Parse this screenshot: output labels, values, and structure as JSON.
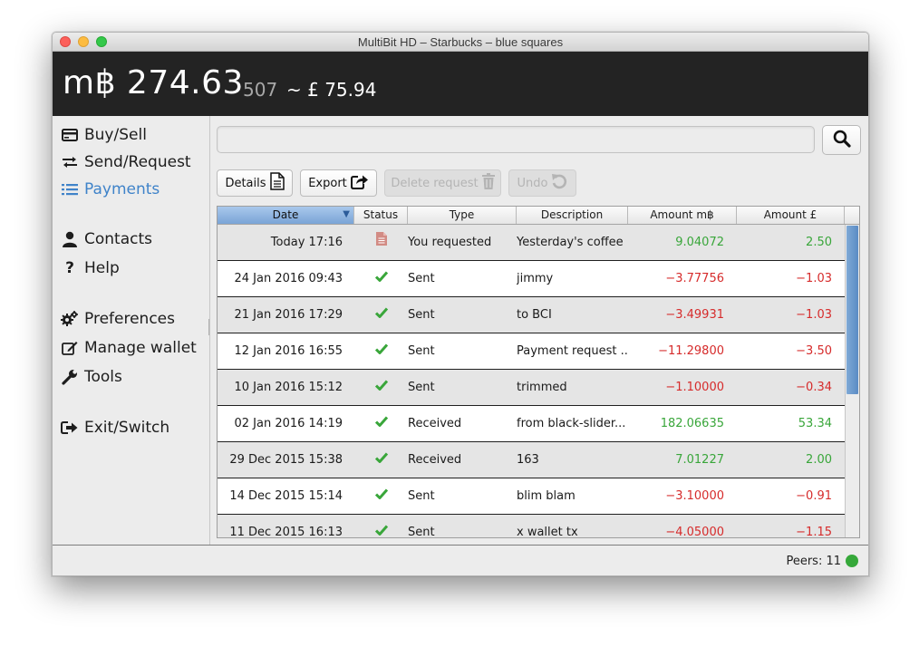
{
  "window": {
    "title": "MultiBit HD – Starbucks – blue squares"
  },
  "header": {
    "balance_main": "m฿ 274.63",
    "balance_small": "507",
    "balance_fiat": "~ £ 75.94"
  },
  "sidebar": {
    "items": [
      {
        "label": "Buy/Sell",
        "icon": "credit-card-icon"
      },
      {
        "label": "Send/Request",
        "icon": "exchange-arrows-icon"
      },
      {
        "label": "Payments",
        "icon": "list-icon",
        "active": true
      },
      {
        "label": "Contacts",
        "icon": "user-icon"
      },
      {
        "label": "Help",
        "icon": "question-icon"
      },
      {
        "label": "Preferences",
        "icon": "cogs-icon"
      },
      {
        "label": "Manage wallet",
        "icon": "edit-icon"
      },
      {
        "label": "Tools",
        "icon": "wrench-icon"
      },
      {
        "label": "Exit/Switch",
        "icon": "sign-out-icon"
      }
    ]
  },
  "search": {
    "value": "",
    "placeholder": "",
    "button_icon": "search-icon"
  },
  "toolbar": {
    "details": "Details",
    "export": "Export",
    "delete_request": "Delete request",
    "undo": "Undo"
  },
  "table": {
    "columns": [
      "Date",
      "Status",
      "Type",
      "Description",
      "Amount  m฿",
      "Amount £"
    ],
    "rows": [
      {
        "date": "Today 17:16",
        "status": "document-icon",
        "type": "You requested",
        "description": "Yesterday's coffee",
        "amount": "9.04072",
        "fiat": "2.50"
      },
      {
        "date": "24 Jan 2016 09:43",
        "status": "check-icon",
        "type": "Sent",
        "description": "jimmy",
        "amount": "−3.77756",
        "fiat": "−1.03"
      },
      {
        "date": "21 Jan 2016 17:29",
        "status": "check-icon",
        "type": "Sent",
        "description": "to BCI",
        "amount": "−3.49931",
        "fiat": "−1.03"
      },
      {
        "date": "12 Jan 2016 16:55",
        "status": "check-icon",
        "type": "Sent",
        "description": "Payment request ...",
        "amount": "−11.29800",
        "fiat": "−3.50"
      },
      {
        "date": "10 Jan 2016 15:12",
        "status": "check-icon",
        "type": "Sent",
        "description": "trimmed",
        "amount": "−1.10000",
        "fiat": "−0.34"
      },
      {
        "date": "02 Jan 2016 14:19",
        "status": "check-icon",
        "type": "Received",
        "description": "from black-slider...",
        "amount": "182.06635",
        "fiat": "53.34"
      },
      {
        "date": "29 Dec 2015 15:38",
        "status": "check-icon",
        "type": "Received",
        "description": "163",
        "amount": "7.01227",
        "fiat": "2.00"
      },
      {
        "date": "14 Dec 2015 15:14",
        "status": "check-icon",
        "type": "Sent",
        "description": "blim blam",
        "amount": "−3.10000",
        "fiat": "−0.91"
      },
      {
        "date": "11 Dec 2015 16:13",
        "status": "check-icon",
        "type": "Sent",
        "description": "x wallet tx",
        "amount": "−4.05000",
        "fiat": "−1.15"
      }
    ]
  },
  "statusbar": {
    "peers": "Peers: 11"
  },
  "colors": {
    "active_nav": "#3f83c9",
    "positive": "#39a63a",
    "negative": "#d62b2b",
    "header_bg": "#232323",
    "peer_ok": "#36a83a"
  }
}
